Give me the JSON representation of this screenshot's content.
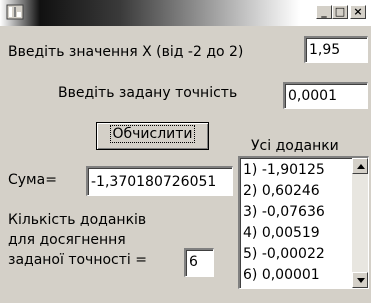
{
  "window": {
    "title": "",
    "controls": {
      "minimize": "_",
      "maximize": "□",
      "close": "×"
    }
  },
  "x_input": {
    "label": "Введіть значення X (від -2 до 2)",
    "value": "1,95"
  },
  "precision_input": {
    "label": "Введіть задану точність",
    "value": "0,0001"
  },
  "compute_button": {
    "label": "Обчислити"
  },
  "sum": {
    "label": "Сума=",
    "value": "-1,370180726051"
  },
  "terms_list": {
    "label": "Усі доданки",
    "items": [
      "1) -1,90125",
      "2) 0,60246",
      "3) -0,07636",
      "4) 0,00519",
      "5) -0,00022",
      "6) 0,00001"
    ]
  },
  "count": {
    "label_line1": "Кількість доданків",
    "label_line2": "для досягнення",
    "label_line3": "заданої точності =",
    "value": "6"
  }
}
